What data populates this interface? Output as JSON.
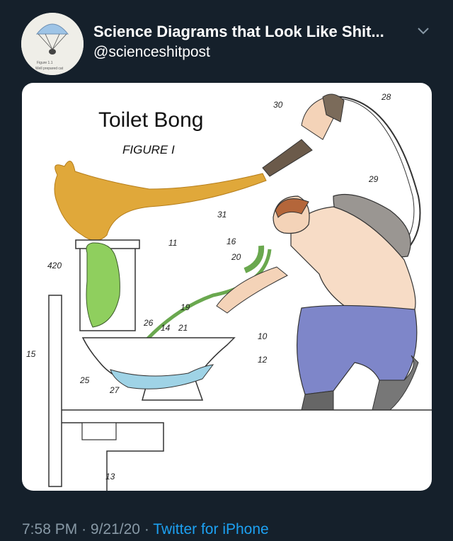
{
  "tweet": {
    "display_name": "Science Diagrams that Look Like Shit...",
    "handle": "@scienceshitpost",
    "avatar_caption": [
      "Figure 1.1",
      "Well prepared cat"
    ],
    "time": "7:58 PM",
    "separator": "·",
    "date": "9/21/20",
    "source": "Twitter for iPhone"
  },
  "diagram": {
    "title": "Toilet Bong",
    "subtitle": "FIGURE I",
    "labels": [
      "30",
      "28",
      "29",
      "31",
      "16",
      "20",
      "11",
      "420",
      "19",
      "26",
      "14",
      "21",
      "10",
      "12",
      "15",
      "25",
      "27",
      "13"
    ]
  },
  "colors": {
    "background": "#15202b",
    "text_primary": "#ffffff",
    "text_secondary": "#8899a6",
    "link": "#1da1f2",
    "smoke": "#e0a83a",
    "green": "#8fcf5e",
    "water": "#9fd3e6",
    "pants": "#7e86c9",
    "skin": "#f4d3b8"
  },
  "icons": [
    "chevron-down-icon",
    "parachute-cat-icon"
  ]
}
